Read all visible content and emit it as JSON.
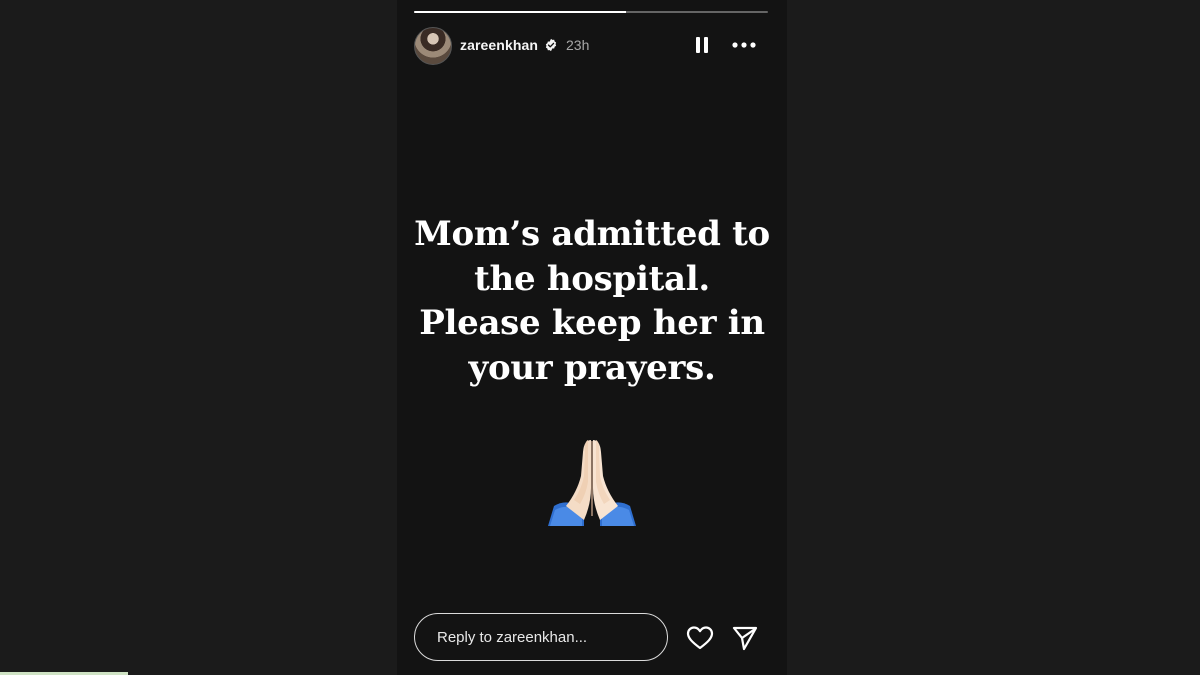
{
  "story": {
    "progress_fraction": 0.6,
    "user": {
      "username": "zareenkhan",
      "verified": true,
      "time_ago": "23h",
      "avatar_icon": "profile-avatar"
    },
    "controls": {
      "pause_icon": "pause-icon",
      "more_icon": "more-options-icon"
    },
    "message": {
      "lines": [
        "Mom’s admitted to",
        "the hospital.",
        "Please keep her in",
        "your prayers."
      ],
      "emoji": "folded-hands-icon"
    },
    "footer": {
      "reply_placeholder": "Reply to zareenkhan...",
      "like_icon": "heart-icon",
      "share_icon": "send-icon"
    }
  },
  "colors": {
    "page_bg": "#1b1b1b",
    "story_bg": "#131313",
    "text_primary": "#ffffff",
    "text_secondary": "#a8a8a8",
    "verified_blue": "#ffffff"
  }
}
